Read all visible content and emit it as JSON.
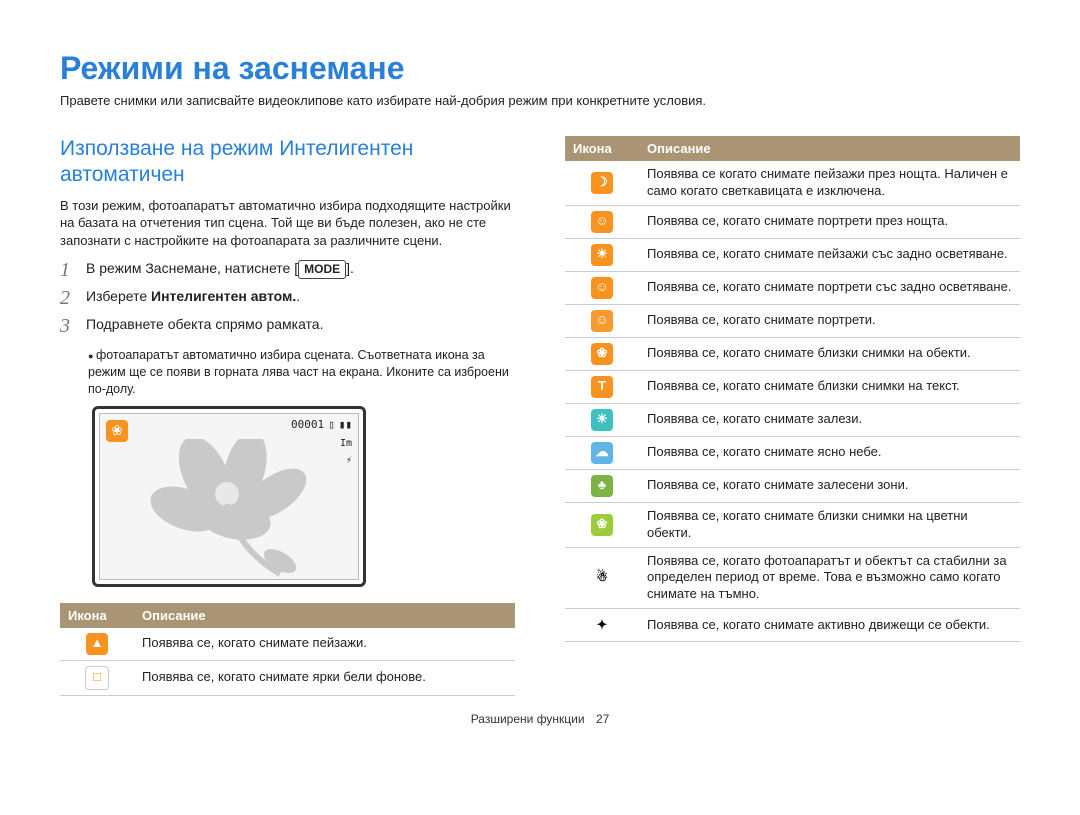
{
  "title": "Режими на заснемане",
  "intro": "Правете снимки или записвайте видеоклипове като избирате най-добрия режим при конкретните условия.",
  "section_title": "Използване на режим Интелигентен автоматичен",
  "section_body": "В този режим, фотоапаратът автоматично избира подходящите настройки на базата на отчетения тип сцена. Той ще ви бъде полезен, ако не сте запознати с настройките на фотоапарата за различните сцени.",
  "steps": {
    "s1_pre": "В режим Заснемане, натиснете [",
    "s1_mode": "MODE",
    "s1_post": "].",
    "s2_pre": "Изберете ",
    "s2_bold": "Интелигентен автом.",
    "s2_post": ".",
    "s3": "Подравнете обекта спрямо рамката.",
    "s3_sub": "фотоапаратът автоматично избира сцената. Съответната икона за режим ще се появи в горната лява част на екрана. Иконите са изброени по-долу."
  },
  "screen": {
    "counter": "00001",
    "size_label": "Im",
    "flash_label": "⚡"
  },
  "table_headers": {
    "icon": "Икона",
    "desc": "Описание"
  },
  "left_rows": [
    {
      "glyph": "▲",
      "cls": "c-orange",
      "desc": "Появява се, когато снимате пейзажи."
    },
    {
      "glyph": "□",
      "cls": "c-white",
      "desc": "Появява се, когато снимате ярки бели фонове."
    }
  ],
  "right_rows": [
    {
      "glyph": "☽",
      "cls": "c-orange",
      "desc": "Появява се когато снимате пейзажи през нощта. Наличен е само когато светкавицата е изключена."
    },
    {
      "glyph": "☺",
      "cls": "c-orange",
      "desc": "Появява се, когато снимате портрети през нощта."
    },
    {
      "glyph": "☀",
      "cls": "c-orange",
      "desc": "Появява се, когато снимате пейзажи със задно осветяване."
    },
    {
      "glyph": "☺",
      "cls": "c-orange",
      "desc": "Появява се, когато снимате портрети със задно осветяване."
    },
    {
      "glyph": "☺",
      "cls": "c-orange2",
      "desc": "Появява се, когато снимате портрети."
    },
    {
      "glyph": "❀",
      "cls": "c-orange",
      "desc": "Появява се, когато снимате близки снимки на обекти."
    },
    {
      "glyph": "T",
      "cls": "c-orange",
      "desc": "Появява се, когато снимате близки снимки на текст."
    },
    {
      "glyph": "☀",
      "cls": "c-teal",
      "desc": "Появява се, когато снимате залези."
    },
    {
      "glyph": "☁",
      "cls": "c-skyblue",
      "desc": "Появява се, когато снимате ясно небе."
    },
    {
      "glyph": "♣",
      "cls": "c-green",
      "desc": "Появява се, когато снимате залесени зони."
    },
    {
      "glyph": "❀",
      "cls": "c-lime",
      "desc": "Появява се, когато снимате близки снимки на цветни обекти."
    },
    {
      "glyph": "☃",
      "cls": "c-black",
      "desc": "Появява се, когато фотоапаратът и обектът са стабилни за определен период от време. Това е възможно само когато снимате на тъмно."
    },
    {
      "glyph": "✦",
      "cls": "c-black",
      "desc": "Появява се, когато снимате активно движещи се обекти."
    }
  ],
  "footer": {
    "label": "Разширени функции",
    "page": "27"
  }
}
